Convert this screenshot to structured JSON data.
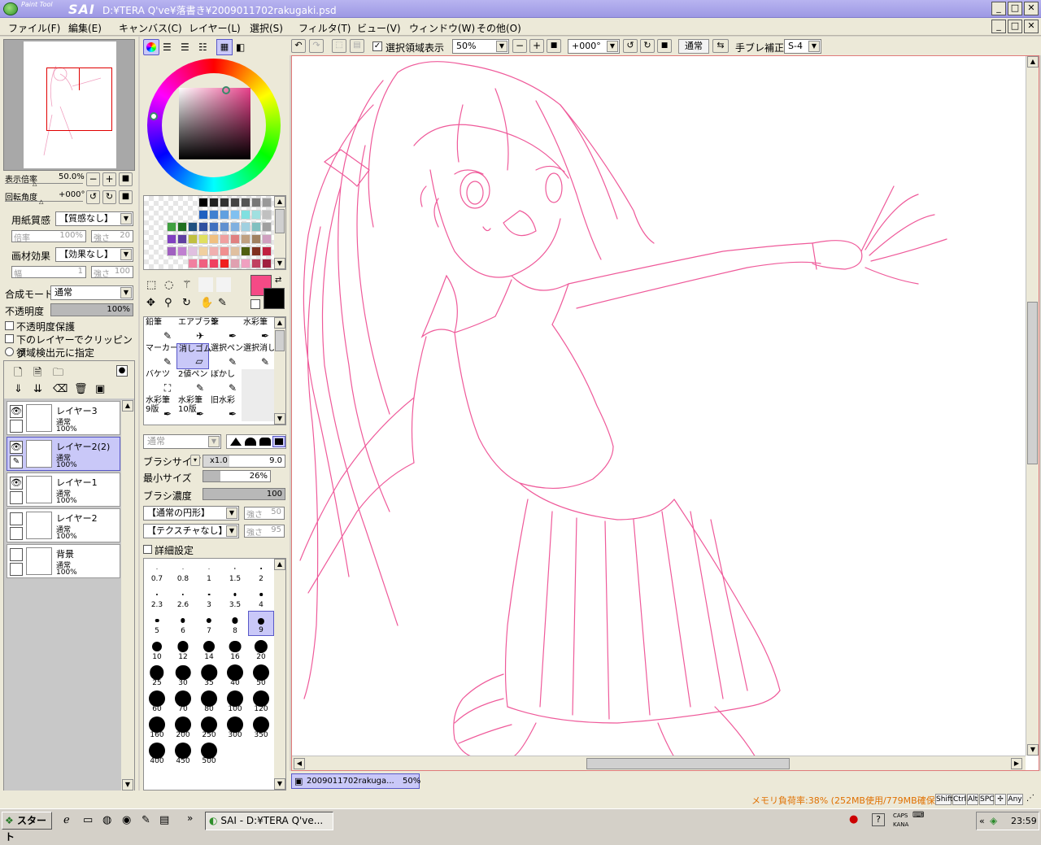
{
  "app": {
    "logo_small": "Paint Tool",
    "logo_big": "SAI",
    "window_title": "D:¥TERA Q've¥落書き¥2009011702rakugaki.psd"
  },
  "menu": [
    "ファイル(F)",
    "編集(E)",
    "キャンバス(C)",
    "レイヤー(L)",
    "選択(S)",
    "フィルタ(T)",
    "ビュー(V)",
    "ウィンドウ(W)",
    "その他(O)"
  ],
  "navigator": {
    "zoom_label": "表示倍率",
    "zoom_value": "50.0%",
    "rotate_label": "回転角度",
    "rotate_value": "+000°"
  },
  "paper": {
    "texture_label": "用紙質感",
    "texture_value": "【質感なし】",
    "texture_strength_label": "倍率",
    "texture_strength_value": "100%",
    "texture_intensity_label": "強さ",
    "texture_intensity_value": "20",
    "effect_label": "画材効果",
    "effect_value": "【効果なし】",
    "effect_width_label": "幅",
    "effect_width_value": "1",
    "effect_strength_label": "強さ",
    "effect_strength_value": "100"
  },
  "layer_props": {
    "blend_label": "合成モード",
    "blend_value": "通常",
    "opacity_label": "不透明度",
    "opacity_value": "100%",
    "opacity_fraction": 1.0,
    "protect_label": "不透明度保護",
    "clip_label": "下のレイヤーでクリッピング",
    "source_label": "領域検出元に指定"
  },
  "layers": [
    {
      "name": "レイヤー3",
      "mode": "通常",
      "opacity": "100%",
      "visible": true,
      "active": false
    },
    {
      "name": "レイヤー2(2)",
      "mode": "通常",
      "opacity": "100%",
      "visible": true,
      "active": true
    },
    {
      "name": "レイヤー1",
      "mode": "通常",
      "opacity": "100%",
      "visible": true,
      "active": false
    },
    {
      "name": "レイヤー2",
      "mode": "通常",
      "opacity": "100%",
      "visible": false,
      "active": false
    },
    {
      "name": "背景",
      "mode": "通常",
      "opacity": "100%",
      "visible": false,
      "active": false
    }
  ],
  "colors": {
    "primary": "#f54a86",
    "secondary": "#000000",
    "accent": "#c9c8f8",
    "line": "#ef5a9a"
  },
  "tools": [
    {
      "label": "鉛筆",
      "icon": "pencil-icon"
    },
    {
      "label": "エアブラシ",
      "icon": "airbrush-icon"
    },
    {
      "label": "筆",
      "icon": "brush-icon"
    },
    {
      "label": "水彩筆",
      "icon": "watercolor-icon"
    },
    {
      "label": "マーカー",
      "icon": "marker-icon"
    },
    {
      "label": "消しゴム",
      "icon": "eraser-icon"
    },
    {
      "label": "選択ペン",
      "icon": "select-pen-icon"
    },
    {
      "label": "選択消し",
      "icon": "select-erase-icon"
    },
    {
      "label": "バケツ",
      "icon": "bucket-icon"
    },
    {
      "label": "2値ペン",
      "icon": "binary-pen-icon"
    },
    {
      "label": "ぼかし",
      "icon": "blur-icon"
    },
    {
      "label": "",
      "icon": ""
    },
    {
      "label": "水彩筆\n9版",
      "icon": "watercolor-9-icon"
    },
    {
      "label": "水彩筆\n10版",
      "icon": "watercolor-10-icon"
    },
    {
      "label": "旧水彩",
      "icon": "old-watercolor-icon"
    },
    {
      "label": "",
      "icon": ""
    }
  ],
  "brush": {
    "mode_value": "通常",
    "size_label": "ブラシサイズ",
    "size_mult": "x1.0",
    "size_value": "9.0",
    "min_label": "最小サイズ",
    "min_value": "26%",
    "min_fraction": 0.26,
    "density_label": "ブラシ濃度",
    "density_value": "100",
    "density_fraction": 1.0,
    "shape_value": "【通常の円形】",
    "shape_strength_label": "強さ",
    "shape_strength_value": "50",
    "texture_value": "【テクスチャなし】",
    "texture_strength_label": "強さ",
    "texture_strength_value": "95",
    "detail_label": "詳細設定"
  },
  "brush_sizes": [
    "0.7",
    "0.8",
    "1",
    "1.5",
    "2",
    "2.3",
    "2.6",
    "3",
    "3.5",
    "4",
    "5",
    "6",
    "7",
    "8",
    "9",
    "10",
    "12",
    "14",
    "16",
    "20",
    "25",
    "30",
    "35",
    "40",
    "50",
    "60",
    "70",
    "80",
    "100",
    "120",
    "160",
    "200",
    "250",
    "300",
    "350",
    "400",
    "450",
    "500"
  ],
  "toolbar": {
    "show_selection_label": "選択領域表示",
    "zoom_value": "50%",
    "rotate_value": "+000°",
    "mode_value": "通常",
    "stabilizer_label": "手ブレ補正",
    "stabilizer_value": "S-4"
  },
  "doc_tab": {
    "name": "2009011702rakuga...",
    "zoom": "50%"
  },
  "status": {
    "memory": "メモリ負荷率:38% (252MB使用/779MB確保)",
    "keys": [
      "Shift",
      "Ctrl",
      "Alt",
      "SPC",
      "Any"
    ]
  },
  "taskbar": {
    "start_label": "スタート",
    "task_label": "SAI - D:¥TERA Q've...",
    "caps": "CAPS",
    "kana": "KANA",
    "clock": "23:59"
  }
}
